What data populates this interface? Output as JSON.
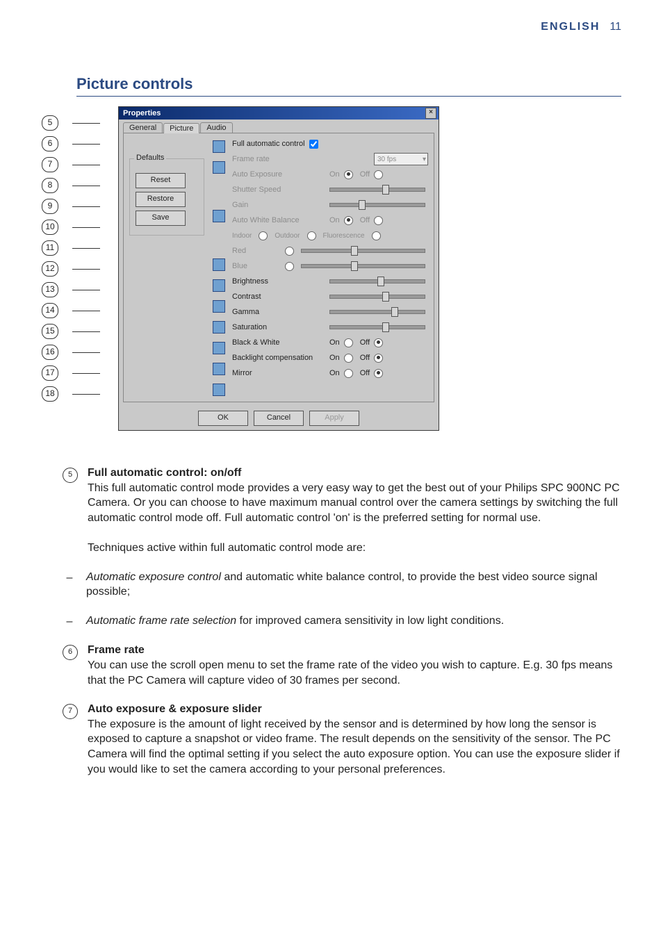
{
  "header": {
    "language": "ENGLISH",
    "page": "11"
  },
  "section_title": "Picture controls",
  "callout_numbers": [
    "5",
    "6",
    "7",
    "8",
    "9",
    "10",
    "11",
    "12",
    "13",
    "14",
    "15",
    "16",
    "17",
    "18"
  ],
  "dialog": {
    "title": "Properties",
    "close_glyph": "×",
    "tabs": {
      "general": "General",
      "picture": "Picture",
      "audio": "Audio"
    },
    "full_auto_label": "Full automatic control",
    "frame_rate_label": "Frame rate",
    "frame_rate_value": "30 fps",
    "defaults_legend": "Defaults",
    "buttons": {
      "reset": "Reset",
      "restore": "Restore",
      "save": "Save"
    },
    "auto_exposure": "Auto Exposure",
    "shutter_speed": "Shutter Speed",
    "gain": "Gain",
    "auto_white_balance": "Auto White Balance",
    "indoor": "Indoor",
    "outdoor": "Outdoor",
    "fluorescence": "Fluorescence",
    "red": "Red",
    "blue": "Blue",
    "brightness": "Brightness",
    "contrast": "Contrast",
    "gamma": "Gamma",
    "saturation": "Saturation",
    "black_white": "Black & White",
    "backlight_comp": "Backlight compensation",
    "mirror": "Mirror",
    "on": "On",
    "off": "Off",
    "ok": "OK",
    "cancel": "Cancel",
    "apply": "Apply"
  },
  "entries": {
    "e5": {
      "num": "5",
      "title": "Full automatic control: on/off",
      "body": "This full automatic control mode provides a very easy way to get the best out of your Philips SPC 900NC PC Camera. Or you can choose to have maximum manual control over the camera settings by switching the full automatic control mode off. Full automatic control 'on' is the preferred setting for normal use.",
      "lead": "Techniques active within full automatic control mode are:",
      "bullet1_i": "Automatic exposure control",
      "bullet1_rest": " and automatic white balance control, to provide the best video source signal possible;",
      "bullet2_i": "Automatic frame rate selection",
      "bullet2_rest": " for improved camera sensitivity in low light conditions."
    },
    "e6": {
      "num": "6",
      "title": "Frame rate",
      "body": "You can use the scroll open menu to set the frame rate of the video you wish to capture. E.g. 30 fps means that the PC Camera will capture video of 30 frames per second."
    },
    "e7": {
      "num": "7",
      "title": "Auto exposure & exposure slider",
      "body": "The exposure is the amount of light received by the sensor and is determined by how long the sensor is exposed to capture a snapshot or video frame. The result depends on the sensitivity of the sensor. The PC Camera will find the optimal setting if you select the auto exposure option. You can use the exposure slider if you would like to set the camera according to your personal preferences."
    }
  }
}
